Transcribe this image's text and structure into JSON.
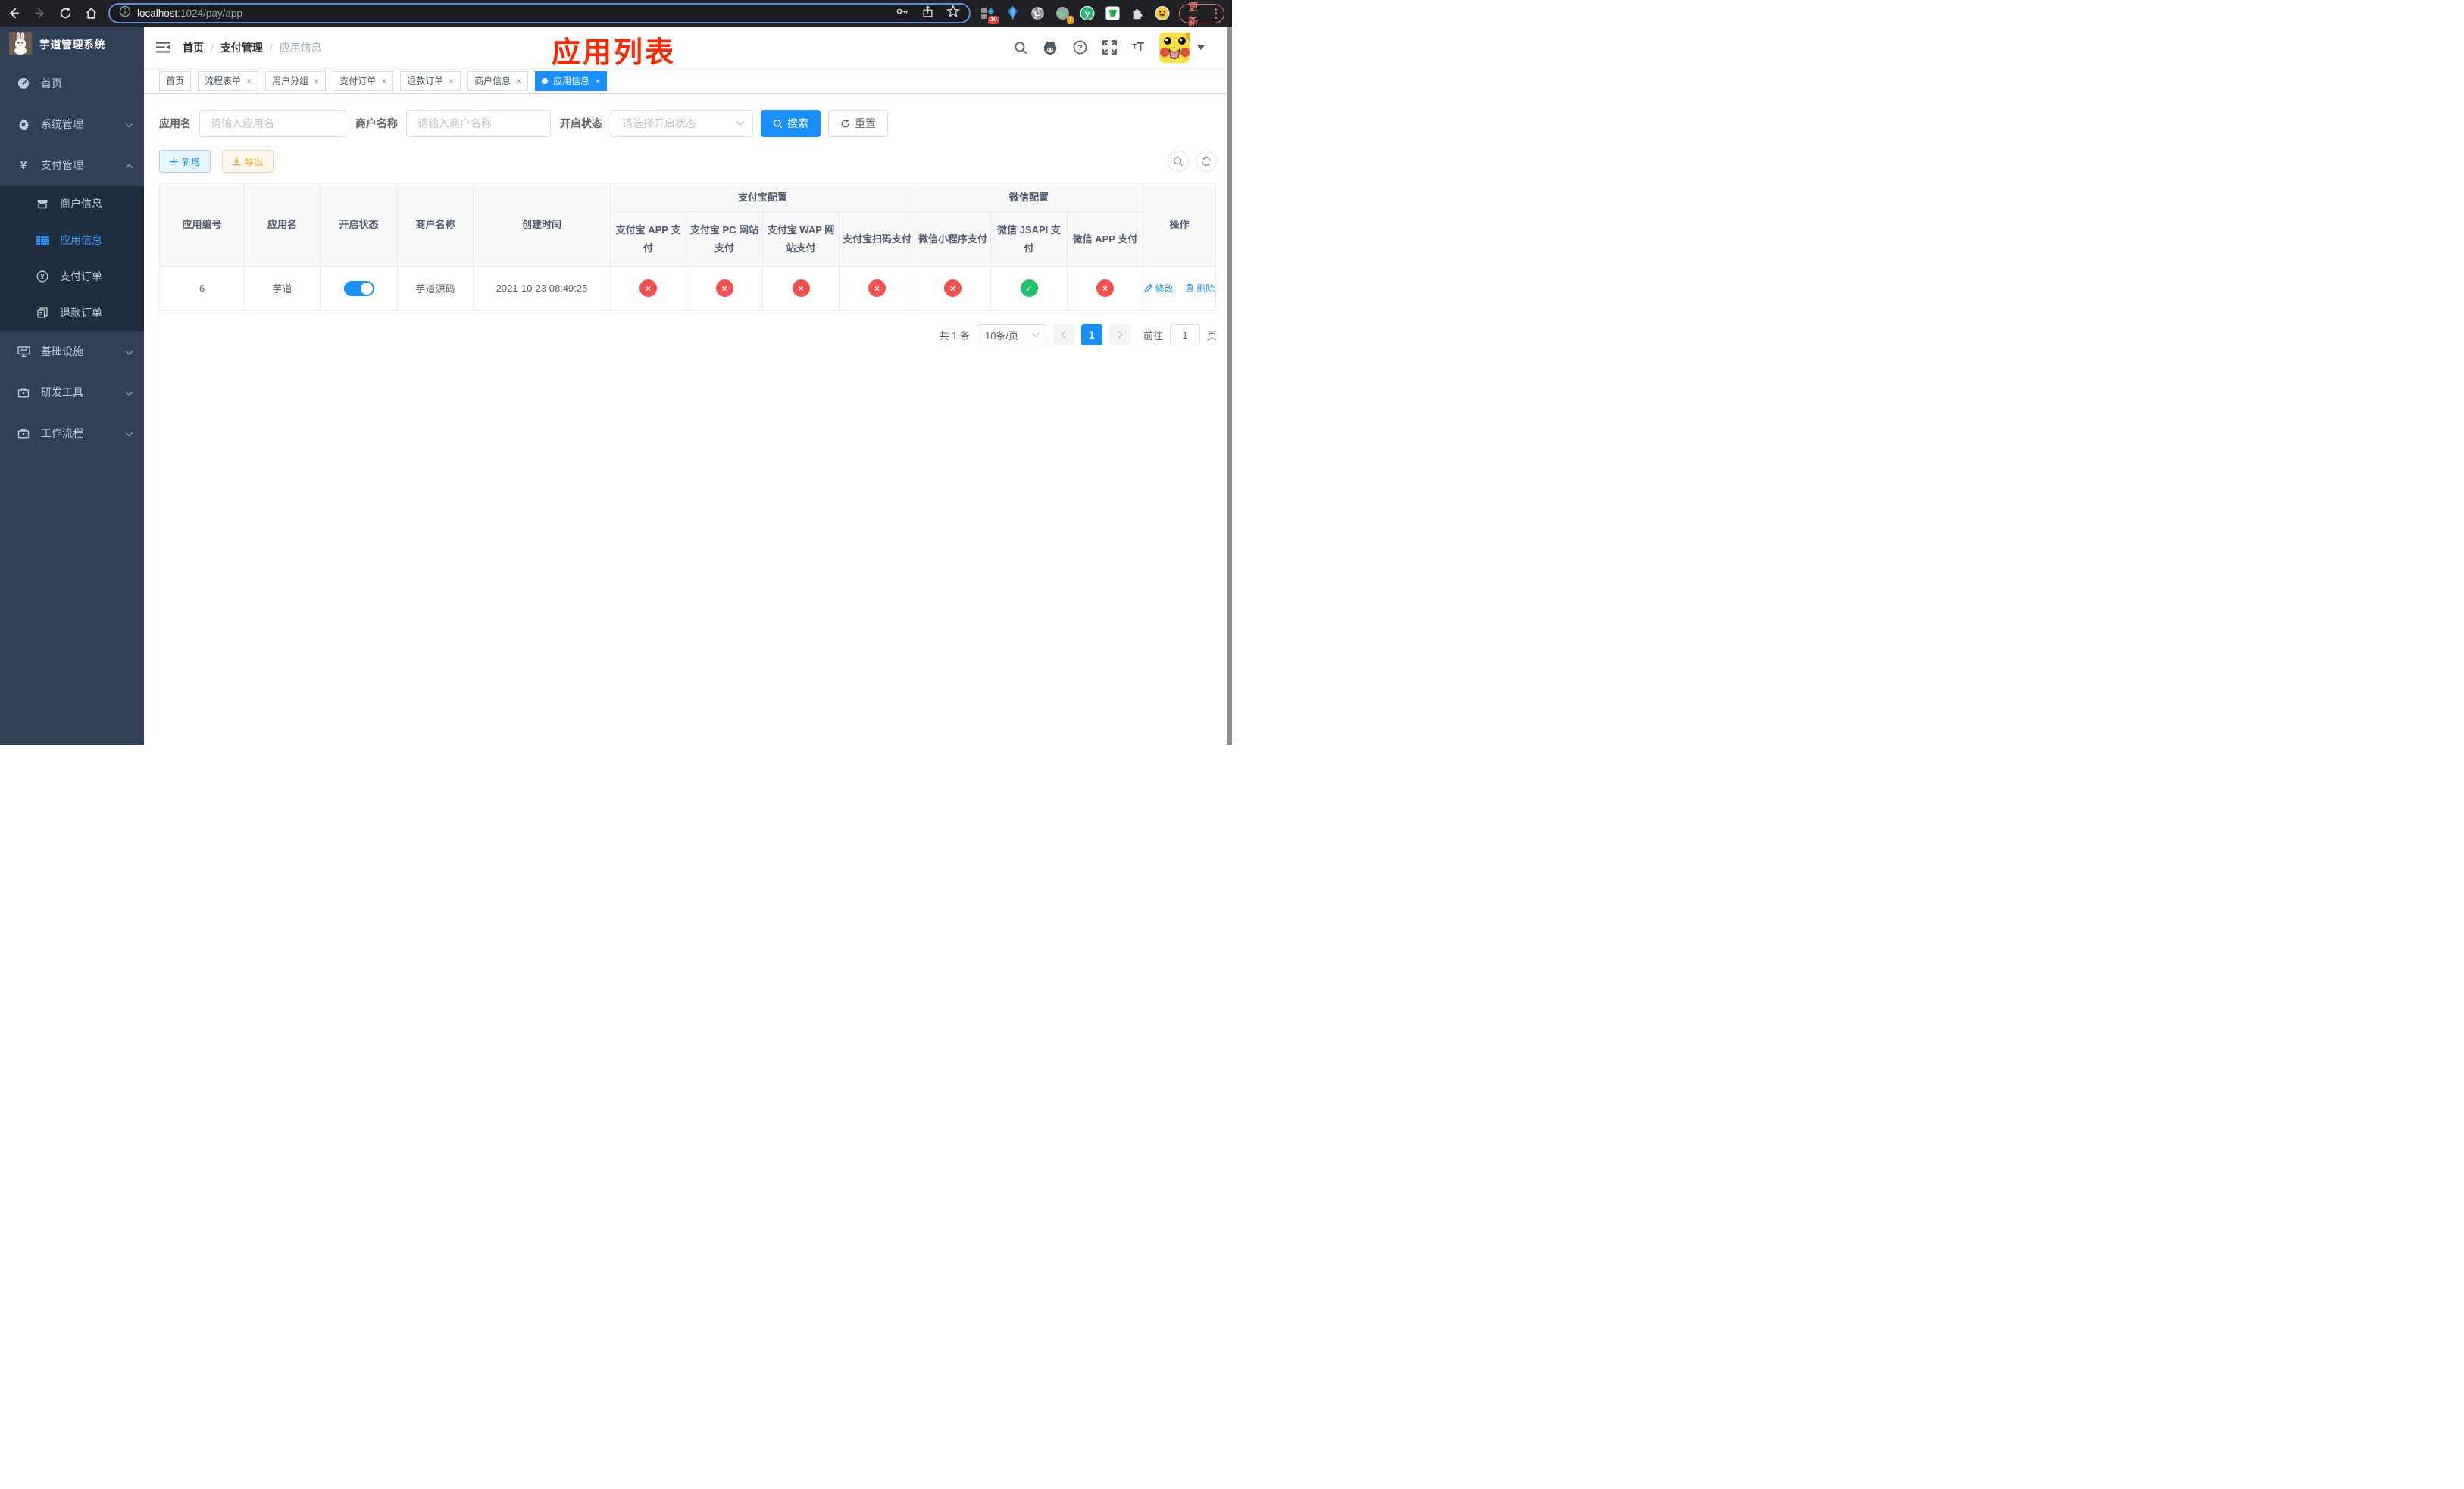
{
  "browser": {
    "url_host": "localhost",
    "url_path": ":1024/pay/app",
    "update_button": "更新",
    "ext_badge_blocks": "10",
    "ext_badge_record": "1"
  },
  "sidebar": {
    "title": "芋道管理系统",
    "items": [
      {
        "label": "首页"
      },
      {
        "label": "系统管理"
      },
      {
        "label": "支付管理"
      },
      {
        "label": "基础设施"
      },
      {
        "label": "研发工具"
      },
      {
        "label": "工作流程"
      }
    ],
    "submenu": [
      {
        "label": "商户信息"
      },
      {
        "label": "应用信息"
      },
      {
        "label": "支付订单"
      },
      {
        "label": "退款订单"
      }
    ]
  },
  "header": {
    "breadcrumb": [
      "首页",
      "支付管理",
      "应用信息"
    ],
    "annotation": "应用列表"
  },
  "tabs": [
    {
      "label": "首页"
    },
    {
      "label": "流程表单"
    },
    {
      "label": "用户分组"
    },
    {
      "label": "支付订单"
    },
    {
      "label": "退款订单"
    },
    {
      "label": "商户信息"
    },
    {
      "label": "应用信息"
    }
  ],
  "search": {
    "app_name_label": "应用名",
    "app_name_placeholder": "请输入应用名",
    "merchant_label": "商户名称",
    "merchant_placeholder": "请输入商户名称",
    "status_label": "开启状态",
    "status_placeholder": "请选择开启状态",
    "search_button": "搜索",
    "reset_button": "重置"
  },
  "toolbar": {
    "add_button": "新增",
    "export_button": "导出"
  },
  "table": {
    "columns": [
      "应用编号",
      "应用名",
      "开启状态",
      "商户名称",
      "创建时间"
    ],
    "alipay_group": "支付宝配置",
    "alipay_columns": [
      "支付宝 APP 支付",
      "支付宝 PC 网站支付",
      "支付宝 WAP 网站支付",
      "支付宝扫码支付"
    ],
    "wechat_group": "微信配置",
    "wechat_columns": [
      "微信小程序支付",
      "微信 JSAPI 支付",
      "微信 APP 支付"
    ],
    "action_column": "操作",
    "row": {
      "id": "6",
      "name": "芋道",
      "enabled": true,
      "merchant": "芋道源码",
      "created": "2021-10-23 08:49:25",
      "config_states": [
        "off",
        "off",
        "off",
        "off",
        "off",
        "on",
        "off"
      ],
      "config_glyphs": [
        "×",
        "×",
        "×",
        "×",
        "×",
        "✓",
        "×"
      ],
      "edit": "修改",
      "delete": "删除"
    }
  },
  "pagination": {
    "total": "共 1 条",
    "page_size": "10条/页",
    "page": "1",
    "goto_label": "前往",
    "goto_value": "1",
    "goto_unit": "页"
  },
  "colors": {
    "accent": "#1890ff",
    "danger": "#f4504f",
    "success": "#22c06a",
    "sidebar_bg": "#304156",
    "submenu_bg": "#1f2d3d",
    "annotation_red": "#ff2600"
  }
}
